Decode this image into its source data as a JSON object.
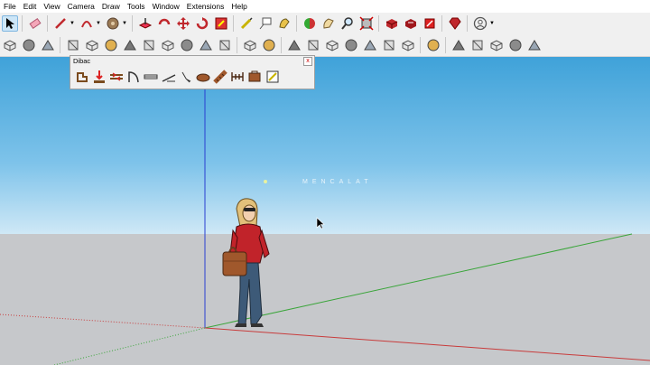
{
  "menu": [
    "File",
    "Edit",
    "View",
    "Camera",
    "Draw",
    "Tools",
    "Window",
    "Extensions",
    "Help"
  ],
  "toolbar_row1": {
    "icons": [
      "select-icon",
      "eraser-icon",
      "pencil-line-icon",
      "arc-icon",
      "paint-bucket-icon",
      "push-pull-icon",
      "rotate-icon",
      "move-icon",
      "scale-icon",
      "tape-measure-icon",
      "text-icon",
      "dimension-icon",
      "orbit-icon",
      "walk-icon",
      "zoom-icon",
      "zoom-extents-icon",
      "3d-warehouse-icon",
      "extension-warehouse-icon",
      "layout-icon",
      "ruby-icon",
      "user-account-icon"
    ]
  },
  "toolbar_row2": {
    "icons": [
      "sandbox-icon",
      "box-icon",
      "cube-icon",
      "sun-icon",
      "shadow-icon",
      "paint-icon",
      "follow-me-icon",
      "offset-icon",
      "protractor-icon",
      "axis-icon",
      "section-icon",
      "hemisphere-icon",
      "circle-icon",
      "layers-icon",
      "group-icon",
      "x-ray-icon",
      "wireframe-icon",
      "hidden-line-icon",
      "shaded-icon",
      "textured-icon",
      "monochrome-icon",
      "components-icon",
      "styles-icon",
      "teapot-icon",
      "outliner-icon",
      "undo-view-icon",
      "redo-view-icon"
    ]
  },
  "dibac": {
    "title": "Dibac",
    "close_label": "x",
    "icons": [
      "wall-icon",
      "extend-wall-icon",
      "join-walls-icon",
      "door-icon",
      "window-icon",
      "stair-icon",
      "lamp-icon",
      "furniture-icon",
      "stairs-icon",
      "glazing-icon",
      "property-icon",
      "floorplan-icon"
    ]
  },
  "scene": {
    "watermark": "MENCALAT",
    "sky_color": "#3fa2d9",
    "ground_color": "#c6c8cb",
    "axis_red": "#c83c3c",
    "axis_green": "#3aa53a",
    "axis_blue": "#2a3fd0"
  }
}
